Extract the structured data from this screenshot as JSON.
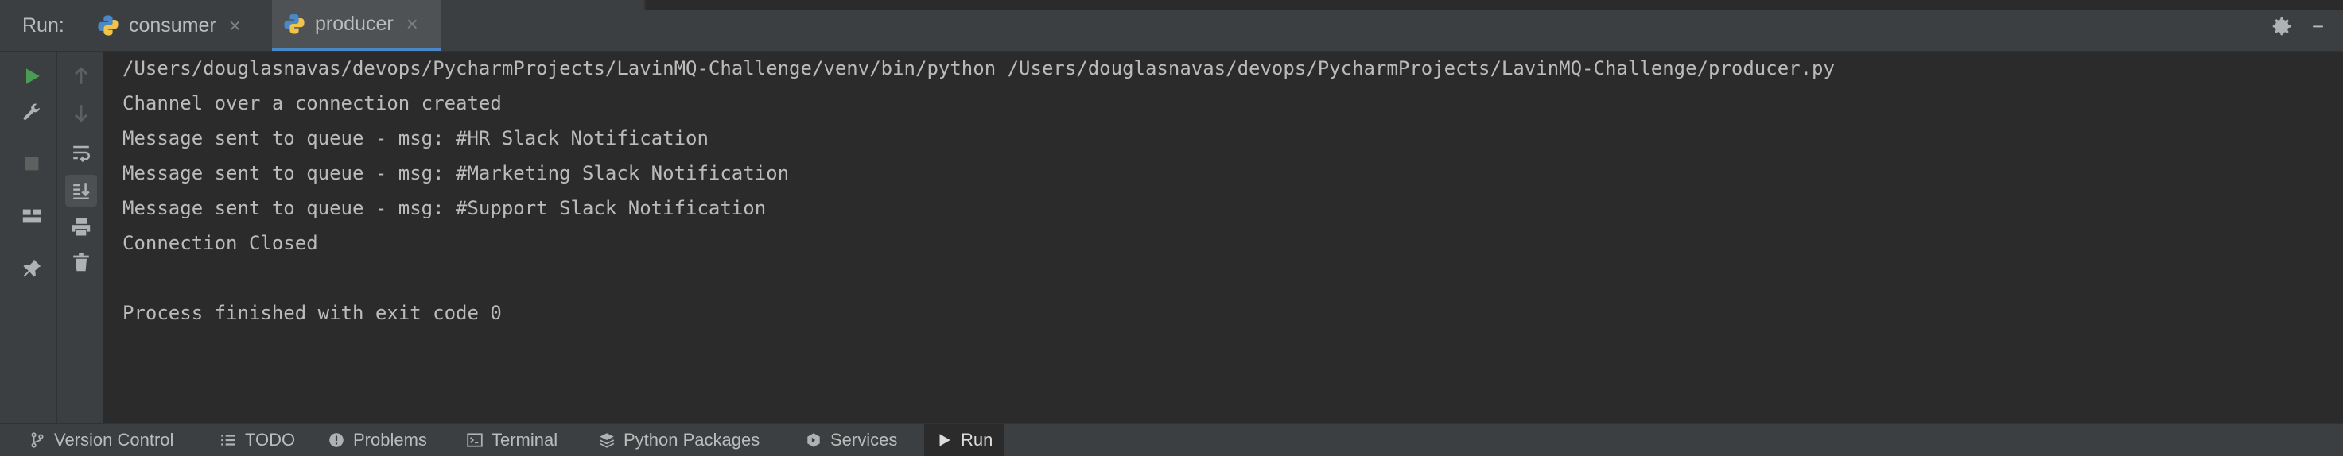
{
  "runbar": {
    "label": "Run:",
    "tabs": [
      {
        "label": "consumer",
        "active": false,
        "icon": "python-icon"
      },
      {
        "label": "producer",
        "active": true,
        "icon": "python-icon"
      }
    ]
  },
  "console": {
    "lines": [
      "/Users/douglasnavas/devops/PycharmProjects/LavinMQ-Challenge/venv/bin/python /Users/douglasnavas/devops/PycharmProjects/LavinMQ-Challenge/producer.py",
      "Channel over a connection created",
      "Message sent to queue - msg: #HR Slack Notification",
      "Message sent to queue - msg: #Marketing Slack Notification",
      "Message sent to queue - msg: #Support Slack Notification",
      "Connection Closed",
      "",
      "Process finished with exit code 0"
    ]
  },
  "bottombar": {
    "items": [
      {
        "label": "Version Control",
        "icon": "branch-icon"
      },
      {
        "label": "TODO",
        "icon": "list-icon"
      },
      {
        "label": "Problems",
        "icon": "alert-icon"
      },
      {
        "label": "Terminal",
        "icon": "terminal-icon"
      },
      {
        "label": "Python Packages",
        "icon": "layers-icon"
      },
      {
        "label": "Services",
        "icon": "services-icon"
      },
      {
        "label": "Run",
        "icon": "play-icon",
        "active": true
      }
    ]
  },
  "colors": {
    "panel": "#3c3f41",
    "console_bg": "#2b2b2b",
    "text": "#bbbbbb",
    "run_green": "#499c54",
    "accent": "#4a88c7"
  }
}
